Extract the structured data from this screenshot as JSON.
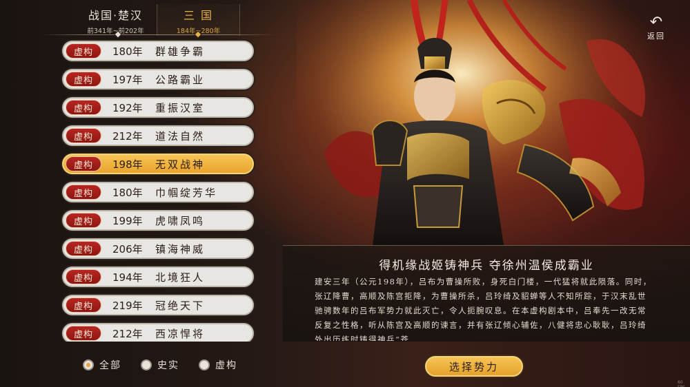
{
  "eras": [
    {
      "name": "战国·楚汉",
      "range": "前341年~前202年",
      "active": false
    },
    {
      "name": "三 国",
      "range": "184年~280年",
      "active": true
    }
  ],
  "scenarios": [
    {
      "badge": "虚构",
      "year": "180年",
      "title": "群雄争霸",
      "selected": false
    },
    {
      "badge": "虚构",
      "year": "197年",
      "title": "公路霸业",
      "selected": false
    },
    {
      "badge": "虚构",
      "year": "192年",
      "title": "重振汉室",
      "selected": false
    },
    {
      "badge": "虚构",
      "year": "212年",
      "title": "道法自然",
      "selected": false
    },
    {
      "badge": "虚构",
      "year": "198年",
      "title": "无双战神",
      "selected": true
    },
    {
      "badge": "虚构",
      "year": "180年",
      "title": "巾帼绽芳华",
      "selected": false
    },
    {
      "badge": "虚构",
      "year": "199年",
      "title": "虎啸凤鸣",
      "selected": false
    },
    {
      "badge": "虚构",
      "year": "206年",
      "title": "镇海神威",
      "selected": false
    },
    {
      "badge": "虚构",
      "year": "194年",
      "title": "北境狂人",
      "selected": false
    },
    {
      "badge": "虚构",
      "year": "219年",
      "title": "冠绝天下",
      "selected": false
    },
    {
      "badge": "虚构",
      "year": "212年",
      "title": "西凉悍将",
      "selected": false
    }
  ],
  "filters": [
    {
      "label": "全部",
      "checked": true
    },
    {
      "label": "史实",
      "checked": false
    },
    {
      "label": "虚构",
      "checked": false
    }
  ],
  "back_label": "返回",
  "description": {
    "title": "得机缘战姬铸神兵 夺徐州温侯成霸业",
    "body": "建安三年（公元198年），吕布为曹操所败，身死白门楼，一代猛将就此陨落。同时，张辽降曹，高顺及陈宫拒降，为曹操所杀，吕玲绮及貂蝉等人不知所踪，于汉末乱世驰骋数年的吕布军势力就此灭亡，令人扼腕叹息。在本虚构剧本中，吕奉先一改无常反复之性格，听从陈宫及高顺的谏言，并有张辽倾心辅佐，八健将忠心耿耿，吕玲绮外出历练时铸得神兵“苍"
  },
  "select_label": "选择势力",
  "fps": "60 FPS",
  "colors": {
    "accent": "#e9a42e",
    "badge": "#b72621"
  }
}
